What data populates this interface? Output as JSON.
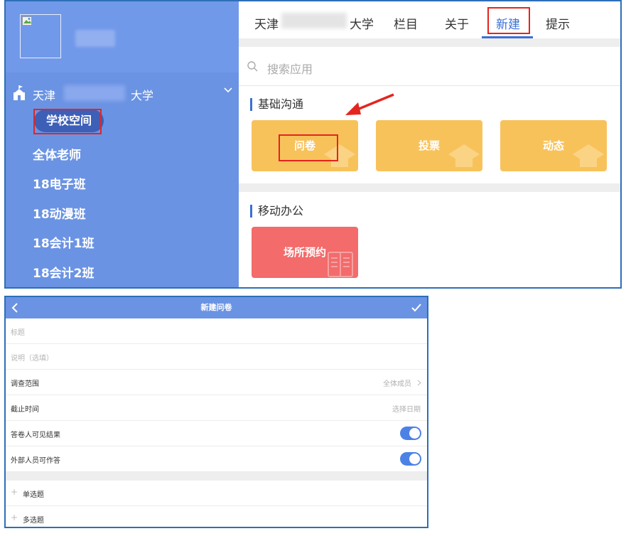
{
  "sidebar": {
    "school_prefix": "天津",
    "school_suffix": "大学",
    "active_item": "学校空间",
    "items": [
      "全体老师",
      "18电子班",
      "18动漫班",
      "18会计1班",
      "18会计2班"
    ]
  },
  "tabs": {
    "school_prefix": "天津",
    "school_suffix": "大学",
    "column": "栏目",
    "about": "关于",
    "new": "新建",
    "tips": "提示"
  },
  "search": {
    "placeholder": "搜索应用"
  },
  "sections": {
    "basic": {
      "title": "基础沟通",
      "apps": [
        "问卷",
        "投票",
        "动态"
      ]
    },
    "mobile": {
      "title": "移动办公",
      "apps": [
        "场所预约"
      ]
    }
  },
  "form": {
    "title": "新建问卷",
    "title_placeholder": "标题",
    "desc_placeholder": "说明（选填）",
    "scope_label": "调查范围",
    "scope_value": "全体成员",
    "deadline_label": "截止时间",
    "deadline_value": "选择日期",
    "visible_label": "答卷人可见结果",
    "external_label": "外部人员可作答",
    "add_single": "单选题",
    "add_multi": "多选题",
    "plus": "+",
    "visible_on": true,
    "external_on": true
  },
  "colors": {
    "sidebar": "#6b93e3",
    "accent": "#3a6fd8",
    "card_yellow": "#f8c25b",
    "card_red": "#f36b6b",
    "highlight": "#e3251f"
  }
}
